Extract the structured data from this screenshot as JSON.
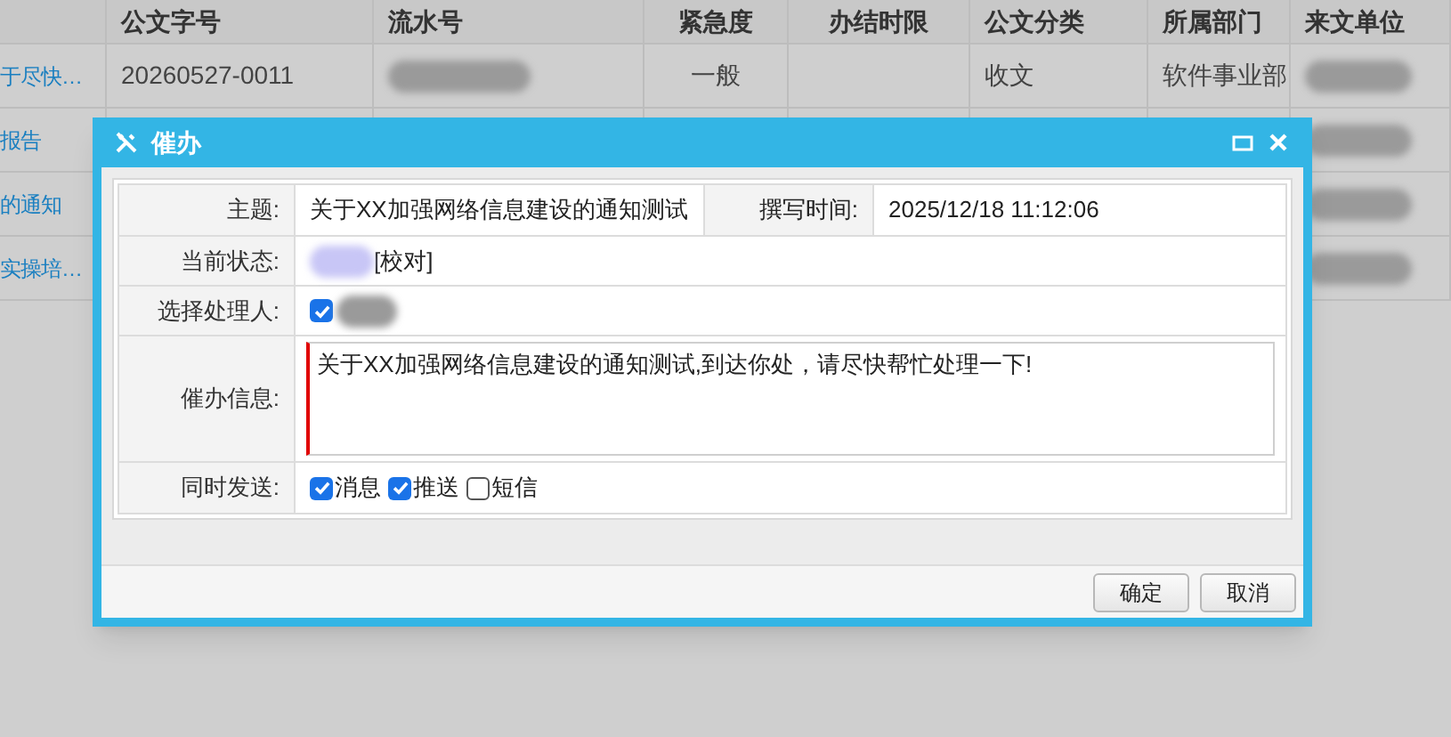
{
  "table": {
    "columns": [
      "",
      "公文字号",
      "流水号",
      "紧急度",
      "办结时限",
      "公文分类",
      "所属部门",
      "来文单位"
    ],
    "rows": [
      {
        "cells": [
          {
            "kind": "link",
            "text": "于尽快…"
          },
          {
            "kind": "text",
            "text": "20260527-0011"
          },
          {
            "kind": "blurred"
          },
          {
            "kind": "center",
            "text": "一般"
          },
          {
            "kind": "empty"
          },
          {
            "kind": "text",
            "text": "收文"
          },
          {
            "kind": "text",
            "text": "软件事业部"
          },
          {
            "kind": "blurred"
          }
        ]
      },
      {
        "cells": [
          {
            "kind": "link",
            "text": "报告"
          },
          {
            "kind": "empty"
          },
          {
            "kind": "empty"
          },
          {
            "kind": "empty"
          },
          {
            "kind": "empty"
          },
          {
            "kind": "empty"
          },
          {
            "kind": "empty"
          },
          {
            "kind": "blurred"
          }
        ]
      },
      {
        "cells": [
          {
            "kind": "link",
            "text": "的通知"
          },
          {
            "kind": "empty"
          },
          {
            "kind": "empty"
          },
          {
            "kind": "empty"
          },
          {
            "kind": "empty"
          },
          {
            "kind": "empty"
          },
          {
            "kind": "empty"
          },
          {
            "kind": "blurred"
          }
        ]
      },
      {
        "cells": [
          {
            "kind": "link",
            "text": "实操培…"
          },
          {
            "kind": "empty"
          },
          {
            "kind": "empty"
          },
          {
            "kind": "empty"
          },
          {
            "kind": "empty"
          },
          {
            "kind": "empty"
          },
          {
            "kind": "empty"
          },
          {
            "kind": "blurred"
          }
        ]
      }
    ]
  },
  "dialog": {
    "title": "催办",
    "subject_label": "主题:",
    "subject": "关于XX加强网络信息建设的通知测试",
    "time_label": "撰写时间:",
    "time": "2025/12/18 11:12:06",
    "status_label": "当前状态:",
    "status": "[校对]",
    "handler_label": "选择处理人:",
    "handler_checked": true,
    "message_label": "催办信息:",
    "message": "关于XX加强网络信息建设的通知测试,到达你处，请尽快帮忙处理一下!",
    "send_label": "同时发送:",
    "send_options": [
      {
        "label": "消息",
        "checked": true
      },
      {
        "label": "推送",
        "checked": true
      },
      {
        "label": "短信",
        "checked": false
      }
    ],
    "buttons": [
      "确定",
      "取消"
    ]
  }
}
